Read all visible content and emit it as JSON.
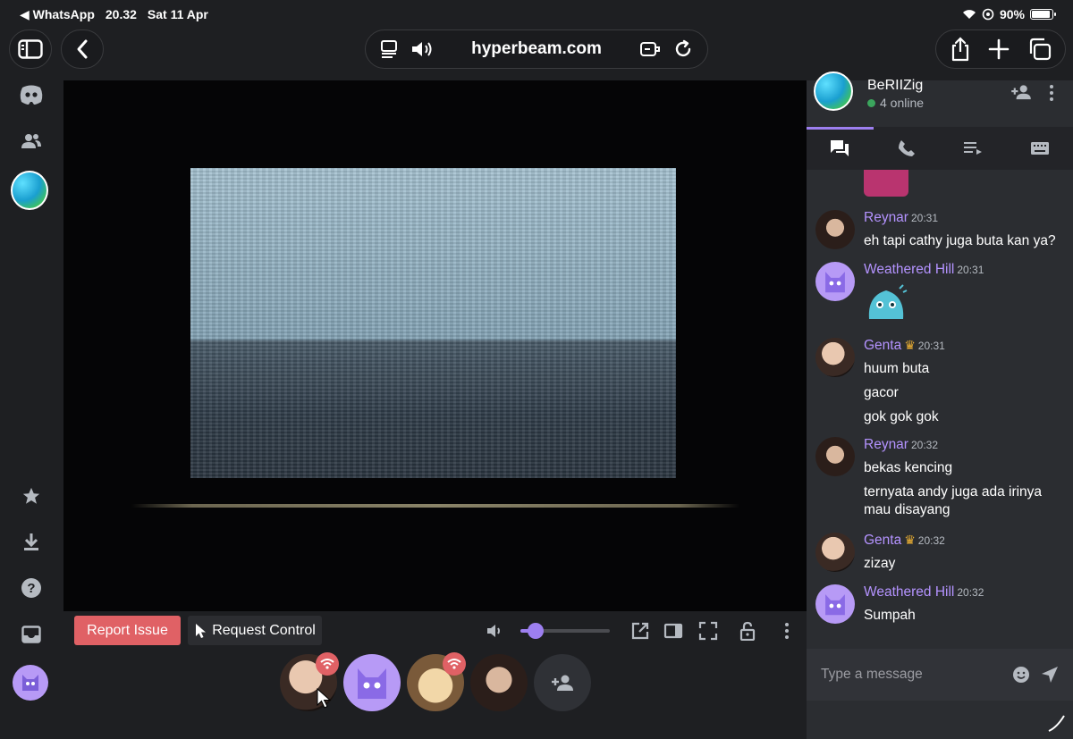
{
  "status_bar": {
    "back_app": "WhatsApp",
    "time": "20.32",
    "date": "Sat 11 Apr",
    "battery": "90%",
    "battery_level": 0.9
  },
  "browser": {
    "url": "hyperbeam.com"
  },
  "chat": {
    "server_name": "BeRIIZig",
    "online": "4 online",
    "messages": [
      {
        "author": "Reynar",
        "time": "20:31",
        "lines": [
          "eh tapi cathy juga buta kan ya?"
        ],
        "crown": false
      },
      {
        "author": "Weathered Hill",
        "time": "20:31",
        "lines": [],
        "crown": false
      },
      {
        "author": "Genta",
        "time": "20:31",
        "lines": [
          "huum buta",
          "gacor",
          "gok gok gok"
        ],
        "crown": true
      },
      {
        "author": "Reynar",
        "time": "20:32",
        "lines": [
          "bekas kencing",
          "ternyata andy juga ada irinya mau disayang"
        ],
        "crown": false
      },
      {
        "author": "Genta",
        "time": "20:32",
        "lines": [
          "zizay"
        ],
        "crown": true
      },
      {
        "author": "Weathered Hill",
        "time": "20:32",
        "lines": [
          "Sumpah"
        ],
        "crown": false
      }
    ],
    "composer_placeholder": "Type a message"
  },
  "controls": {
    "report_label": "Report Issue",
    "request_label": "Request Control",
    "volume_level": 0.17
  },
  "colors": {
    "accent": "#9d7ff0",
    "name": "#b493ff",
    "report": "#e06165",
    "crown": "#f0b232",
    "online": "#3ba55d"
  }
}
